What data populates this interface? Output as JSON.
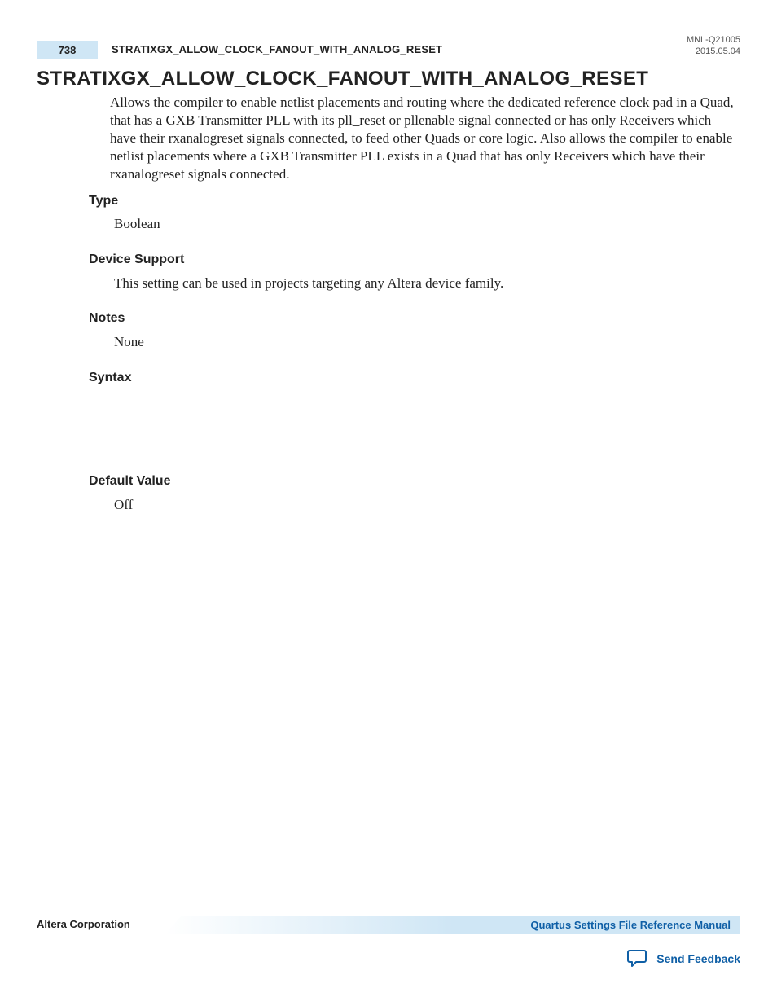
{
  "header": {
    "page_number": "738",
    "running_title": "STRATIXGX_ALLOW_CLOCK_FANOUT_WITH_ANALOG_RESET",
    "doc_id": "MNL-Q21005",
    "doc_date": "2015.05.04"
  },
  "title": "STRATIXGX_ALLOW_CLOCK_FANOUT_WITH_ANALOG_RESET",
  "description": "Allows the compiler to enable netlist placements and routing where the dedicated reference clock pad in a Quad, that has a GXB Transmitter PLL with its pll_reset or pllenable signal connected or has only Receivers which have their rxanalogreset signals connected, to feed other Quads or core logic. Also allows the compiler to enable netlist placements where a GXB Transmitter PLL exists in a Quad that has only Receivers which have their rxanalogreset signals connected.",
  "sections": {
    "type": {
      "label": "Type",
      "value": "Boolean"
    },
    "device_support": {
      "label": "Device Support",
      "value": "This setting can be used in projects targeting any Altera device family."
    },
    "notes": {
      "label": "Notes",
      "value": "None"
    },
    "syntax": {
      "label": "Syntax",
      "value": ""
    },
    "default_value": {
      "label": "Default Value",
      "value": "Off"
    }
  },
  "footer": {
    "company": "Altera Corporation",
    "manual_link": "Quartus Settings File Reference Manual",
    "feedback": "Send Feedback"
  }
}
